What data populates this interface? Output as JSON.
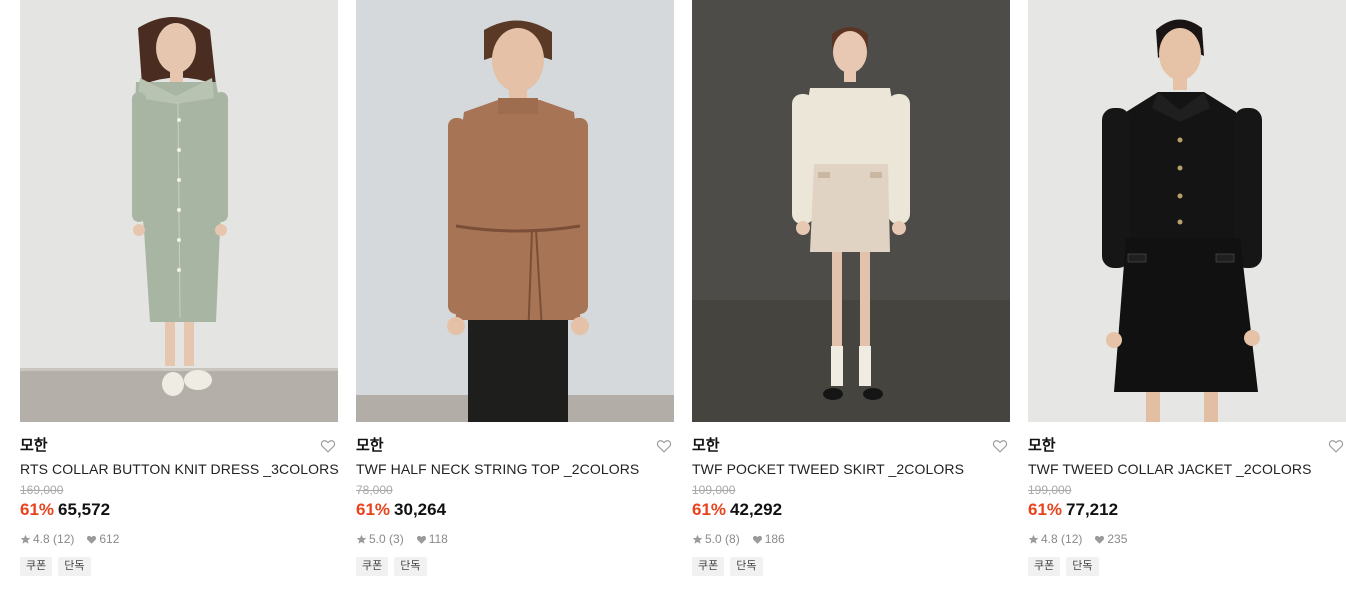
{
  "colors": {
    "discount": "#e8431b",
    "price": "#111111",
    "muted": "#8a8a8a",
    "tag_bg": "#f1f1f1"
  },
  "products": [
    {
      "brand": "모한",
      "title": "RTS COLLAR BUTTON KNIT DRESS _3COLORS",
      "original_price": "169,000",
      "discount": "61%",
      "price": "65,572",
      "rating": "4.8",
      "reviews": "(12)",
      "likes": "612",
      "tags": [
        "쿠폰",
        "단독"
      ],
      "image": "model-in-sage-knit-dress"
    },
    {
      "brand": "모한",
      "title": "TWF HALF NECK STRING TOP _2COLORS",
      "original_price": "78,000",
      "discount": "61%",
      "price": "30,264",
      "rating": "5.0",
      "reviews": "(3)",
      "likes": "118",
      "tags": [
        "쿠폰",
        "단독"
      ],
      "image": "model-in-brown-string-top"
    },
    {
      "brand": "모한",
      "title": "TWF POCKET TWEED SKIRT _2COLORS",
      "original_price": "109,000",
      "discount": "61%",
      "price": "42,292",
      "rating": "5.0",
      "reviews": "(8)",
      "likes": "186",
      "tags": [
        "쿠폰",
        "단독"
      ],
      "image": "model-in-cream-tweed-skirt"
    },
    {
      "brand": "모한",
      "title": "TWF TWEED COLLAR JACKET _2COLORS",
      "original_price": "199,000",
      "discount": "61%",
      "price": "77,212",
      "rating": "4.8",
      "reviews": "(12)",
      "likes": "235",
      "tags": [
        "쿠폰",
        "단독"
      ],
      "image": "model-in-black-tweed-jacket"
    }
  ]
}
